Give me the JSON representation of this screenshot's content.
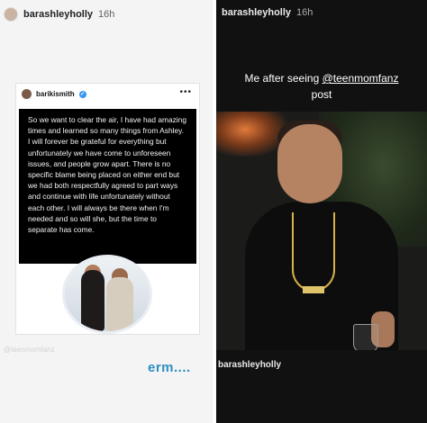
{
  "left_story": {
    "username": "barashleyholly",
    "time": "16h",
    "embed": {
      "account": "barikismith",
      "text": "So we want to clear the air, I have had amazing times and learned so many things from Ashley. I will forever be grateful for everything but unfortunately we have come to unforeseen issues, and people grow apart. There is no specific blame being placed on either end but we had both respectfully agreed to part ways and continue with life unfortunately without each other. I will always be there when I'm needed and so will she, but the time to separate has come."
    },
    "watermark": "@teenmomfanz",
    "reaction": "erm...."
  },
  "right_story": {
    "username": "barashleyholly",
    "time": "16h",
    "caption_prefix": "Me after seeing ",
    "caption_mention": "@teenmomfanz",
    "caption_suffix": "post",
    "bottom_tag": "barashleyholly"
  }
}
